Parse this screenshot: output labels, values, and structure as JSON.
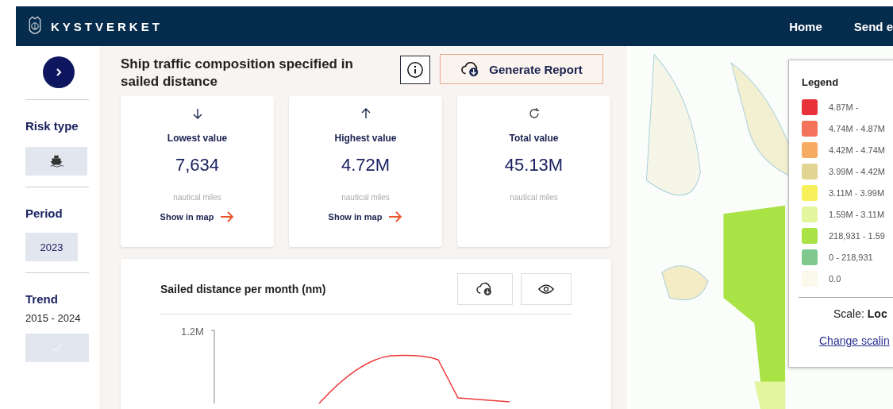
{
  "header": {
    "brand": "KYSTVERKET",
    "nav": [
      {
        "label": "Home"
      },
      {
        "label": "Send e"
      }
    ]
  },
  "sidebar": {
    "risk_type": {
      "label": "Risk type"
    },
    "period": {
      "label": "Period",
      "value": "2023"
    },
    "trend": {
      "label": "Trend",
      "range": "2015 - 2024",
      "checked": true
    }
  },
  "title": "Ship traffic composition specified in sailed distance",
  "generate_button": "Generate Report",
  "cards": [
    {
      "kind": "down",
      "label": "Lowest value",
      "value": "7,634",
      "unit": "nautical miles",
      "link": "Show in map"
    },
    {
      "kind": "up",
      "label": "Highest value",
      "value": "4.72M",
      "unit": "nautical miles",
      "link": "Show in map"
    },
    {
      "kind": "refresh",
      "label": "Total value",
      "value": "45.13M",
      "unit": "nautical miles"
    }
  ],
  "chart": {
    "title": "Sailed distance per month (nm)",
    "y_tick": "1.2M"
  },
  "legend": {
    "title": "Legend",
    "items": [
      {
        "label": "4.87M -",
        "color": "#e8323a"
      },
      {
        "label": "4.74M - 4.87M",
        "color": "#f3735a"
      },
      {
        "label": "4.42M - 4.74M",
        "color": "#f6ab62"
      },
      {
        "label": "3.99M - 4.42M",
        "color": "#e2d493"
      },
      {
        "label": "3.11M - 3.99M",
        "color": "#f7f05a"
      },
      {
        "label": "1.59M - 3.11M",
        "color": "#e3f59d"
      },
      {
        "label": "218,931 - 1.59",
        "color": "#a9e346"
      },
      {
        "label": "0 - 218,931",
        "color": "#7fc98e"
      },
      {
        "label": "0.0",
        "color": "#fbf8ec"
      }
    ],
    "scale": "Scale: **Loc**",
    "change_link": "Change scalin"
  }
}
